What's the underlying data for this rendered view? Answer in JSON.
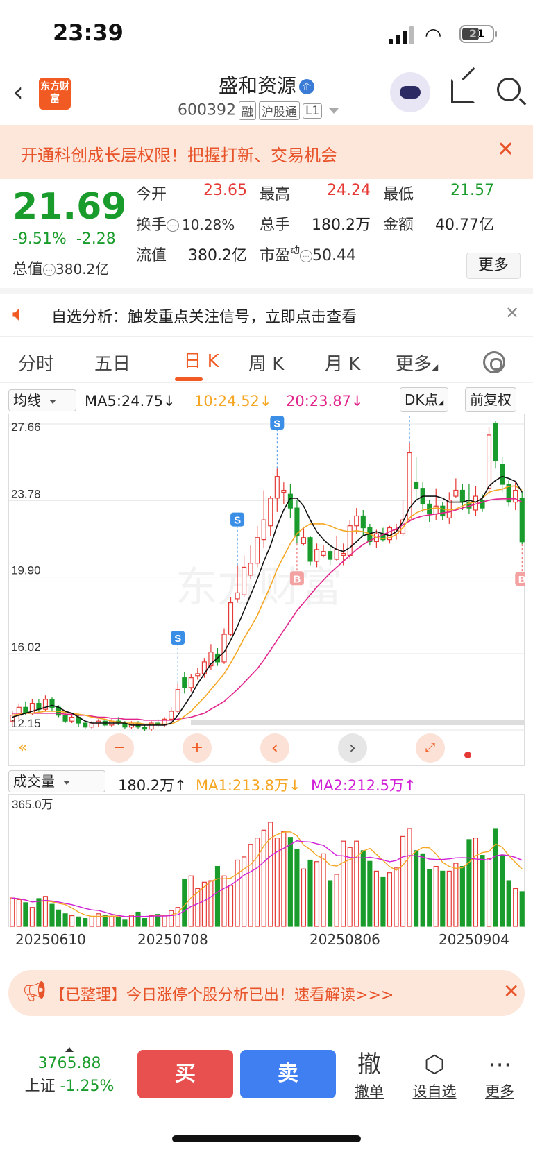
{
  "status": {
    "time": "23:39",
    "battery": "21"
  },
  "header": {
    "back_icon": "chevron-left-icon",
    "logo_text": "东方财富",
    "stock_name": "盛和资源",
    "badge": "企",
    "code": "600392",
    "tags": [
      "融",
      "沪股通",
      "L1"
    ]
  },
  "banner": {
    "text": "开通科创成长层权限！把握打新、交易机会"
  },
  "quote": {
    "price": "21.69",
    "change_pct": "-9.51%",
    "change": "-2.28",
    "open_label": "今开",
    "open": "23.65",
    "high_label": "最高",
    "high": "24.24",
    "low_label": "最低",
    "low": "21.57",
    "turnover_label": "换手",
    "turnover": "10.28%",
    "volume_label": "总手",
    "volume": "180.2万",
    "amount_label": "金额",
    "amount": "40.77亿",
    "mktcap_label": "总值",
    "mktcap": "380.2亿",
    "float_label": "流值",
    "float": "380.2亿",
    "pe_label": "市盈",
    "pe_sup": "动",
    "pe": "50.44",
    "more": "更多"
  },
  "alert": {
    "text": "自选分析：触发重点关注信号，立即点击查看"
  },
  "tabs": {
    "items": [
      "分时",
      "五日",
      "日 K",
      "周 K",
      "月 K",
      "更多"
    ],
    "active": 2
  },
  "ma": {
    "select": "均线",
    "ma5": "MA5:24.75↓",
    "ma10": "10:24.52↓",
    "ma20": "20:23.87↓",
    "dk": "DK点",
    "adj": "前复权",
    "colors": {
      "ma5": "#111111",
      "ma10": "#f5a623",
      "ma20": "#e0248c",
      "up": "#e53935",
      "down": "#1a9c2c"
    }
  },
  "kline": {
    "y_labels": [
      "27.66",
      "23.78",
      "19.90",
      "16.02",
      "12.15"
    ],
    "signals": {
      "sell": "S",
      "buy": "B"
    }
  },
  "volume": {
    "select": "成交量",
    "current": "180.2万↑",
    "ma1": "MA1:213.8万↓",
    "ma2": "MA2:212.5万↑",
    "max_label": "365.0万"
  },
  "dates": [
    "20250610",
    "20250708",
    "20250806",
    "20250904"
  ],
  "promo": {
    "text": "【已整理】今日涨停个股分析已出！速看解读>>>"
  },
  "bottom": {
    "index_value": "3765.88",
    "index_name": "上证",
    "index_change": "-1.25%",
    "buy": "买",
    "sell": "卖",
    "cancel_glyph": "撤",
    "cancel": "撤单",
    "watch": "设自选",
    "more": "更多"
  },
  "chart_data": {
    "type": "candlestick",
    "title": "",
    "y_range": [
      12.15,
      27.66
    ],
    "x_ticks": [
      "20250610",
      "20250708",
      "20250806",
      "20250904"
    ],
    "candles": [
      [
        12.6,
        12.9,
        13.1,
        12.3
      ],
      [
        12.9,
        13.3,
        13.5,
        12.7
      ],
      [
        13.3,
        13.0,
        13.6,
        12.9
      ],
      [
        13.0,
        13.5,
        13.7,
        12.9
      ],
      [
        13.5,
        13.2,
        13.7,
        13.0
      ],
      [
        13.2,
        13.7,
        13.9,
        13.1
      ],
      [
        13.7,
        13.3,
        13.8,
        13.1
      ],
      [
        13.3,
        12.9,
        13.4,
        12.8
      ],
      [
        12.9,
        12.6,
        13.0,
        12.5
      ],
      [
        12.6,
        12.8,
        12.9,
        12.5
      ],
      [
        12.8,
        12.5,
        12.9,
        12.3
      ],
      [
        12.5,
        12.3,
        12.6,
        12.2
      ],
      [
        12.3,
        12.5,
        12.6,
        12.2
      ],
      [
        12.5,
        12.6,
        12.7,
        12.3
      ],
      [
        12.6,
        12.4,
        12.7,
        12.3
      ],
      [
        12.4,
        12.6,
        12.7,
        12.3
      ],
      [
        12.6,
        12.5,
        12.8,
        12.4
      ],
      [
        12.5,
        12.3,
        12.6,
        12.2
      ],
      [
        12.3,
        12.5,
        12.6,
        12.2
      ],
      [
        12.5,
        12.3,
        12.6,
        12.2
      ],
      [
        12.3,
        12.2,
        12.4,
        12.1
      ],
      [
        12.2,
        12.5,
        12.6,
        12.1
      ],
      [
        12.5,
        12.4,
        12.7,
        12.3
      ],
      [
        12.4,
        12.7,
        12.8,
        12.3
      ],
      [
        12.7,
        13.1,
        13.3,
        12.6
      ],
      [
        13.1,
        14.2,
        14.5,
        13.0
      ],
      [
        14.8,
        14.3,
        15.1,
        14.0
      ],
      [
        14.3,
        14.8,
        15.0,
        14.1
      ],
      [
        14.9,
        15.0,
        15.3,
        14.7
      ],
      [
        15.0,
        15.6,
        15.8,
        14.8
      ],
      [
        15.4,
        16.1,
        16.5,
        15.2
      ],
      [
        16.0,
        15.6,
        16.3,
        15.4
      ],
      [
        15.6,
        17.0,
        17.3,
        15.5
      ],
      [
        17.0,
        18.6,
        18.9,
        16.9
      ],
      [
        18.8,
        19.1,
        20.5,
        18.6
      ],
      [
        19.0,
        20.4,
        21.0,
        18.9
      ],
      [
        20.0,
        20.6,
        21.5,
        19.8
      ],
      [
        20.6,
        21.9,
        22.5,
        20.4
      ],
      [
        21.8,
        22.8,
        24.3,
        21.4
      ],
      [
        22.5,
        23.9,
        24.0,
        22.0
      ],
      [
        23.9,
        25.0,
        25.4,
        23.2
      ],
      [
        24.2,
        24.3,
        24.7,
        23.6
      ],
      [
        24.1,
        23.4,
        24.6,
        22.9
      ],
      [
        23.4,
        22.0,
        23.8,
        21.6
      ],
      [
        21.6,
        21.9,
        22.4,
        21.5
      ],
      [
        21.9,
        20.7,
        22.0,
        20.5
      ],
      [
        20.7,
        21.3,
        21.6,
        20.4
      ],
      [
        21.0,
        21.2,
        21.5,
        20.9
      ],
      [
        21.2,
        20.8,
        21.5,
        20.5
      ],
      [
        20.8,
        21.3,
        22.0,
        20.7
      ],
      [
        21.0,
        21.1,
        21.6,
        20.5
      ],
      [
        21.0,
        22.5,
        22.8,
        20.8
      ],
      [
        22.5,
        23.0,
        23.4,
        22.1
      ],
      [
        23.0,
        22.4,
        23.3,
        22.0
      ],
      [
        22.4,
        21.7,
        22.6,
        21.5
      ],
      [
        21.7,
        22.1,
        22.3,
        21.4
      ],
      [
        22.1,
        21.8,
        22.4,
        21.7
      ],
      [
        21.8,
        22.4,
        22.5,
        21.6
      ],
      [
        22.1,
        22.3,
        22.6,
        21.8
      ],
      [
        22.1,
        22.8,
        23.8,
        22.0
      ],
      [
        22.8,
        26.2,
        26.7,
        22.7
      ],
      [
        24.7,
        24.4,
        26.0,
        23.8
      ],
      [
        24.4,
        23.6,
        24.7,
        23.2
      ],
      [
        23.6,
        23.1,
        23.8,
        22.7
      ],
      [
        23.1,
        23.5,
        24.4,
        22.8
      ],
      [
        23.5,
        23.0,
        23.7,
        22.8
      ],
      [
        22.9,
        23.8,
        24.2,
        22.6
      ],
      [
        24.0,
        24.3,
        24.9,
        23.9
      ],
      [
        24.3,
        23.7,
        24.6,
        23.3
      ],
      [
        23.7,
        23.4,
        24.6,
        23.1
      ],
      [
        23.3,
        24.0,
        24.5,
        23.0
      ],
      [
        23.8,
        23.4,
        24.1,
        23.2
      ],
      [
        24.4,
        27.1,
        27.5,
        24.1
      ],
      [
        27.7,
        25.8,
        27.8,
        25.4
      ],
      [
        25.6,
        24.6,
        26.0,
        24.2
      ],
      [
        24.6,
        23.7,
        24.8,
        23.5
      ],
      [
        23.7,
        24.3,
        24.7,
        23.3
      ],
      [
        23.9,
        21.69,
        24.24,
        21.57
      ]
    ],
    "ma5": [
      12.8,
      12.9,
      13.0,
      13.1,
      13.2,
      13.3,
      13.4,
      13.3,
      13.1,
      13.0,
      12.8,
      12.6,
      12.5,
      12.5,
      12.5,
      12.5,
      12.5,
      12.5,
      12.4,
      12.4,
      12.4,
      12.4,
      12.4,
      12.4,
      12.5,
      12.9,
      13.4,
      13.9,
      14.5,
      15.0,
      15.5,
      15.8,
      16.1,
      16.7,
      17.4,
      18.2,
      19.0,
      19.8,
      20.7,
      21.5,
      22.5,
      23.3,
      23.9,
      23.9,
      23.5,
      22.8,
      22.2,
      21.8,
      21.5,
      21.3,
      21.2,
      21.4,
      21.7,
      22.0,
      22.1,
      22.2,
      22.1,
      22.0,
      22.2,
      22.7,
      23.4,
      23.8,
      24.0,
      24.0,
      24.0,
      23.9,
      23.7,
      23.7,
      23.7,
      23.8,
      23.7,
      23.9,
      24.5,
      24.8,
      25.0,
      24.9,
      24.75,
      24.2
    ],
    "ma10": [
      12.9,
      12.95,
      13.0,
      13.0,
      13.05,
      13.1,
      13.1,
      13.1,
      13.05,
      13.0,
      12.95,
      12.9,
      12.8,
      12.75,
      12.7,
      12.6,
      12.55,
      12.5,
      12.5,
      12.5,
      12.45,
      12.45,
      12.45,
      12.45,
      12.45,
      12.6,
      12.85,
      13.1,
      13.45,
      13.8,
      14.2,
      14.6,
      15.0,
      15.55,
      16.15,
      16.8,
      17.35,
      17.95,
      18.7,
      19.45,
      20.3,
      20.95,
      21.6,
      22.1,
      22.4,
      22.6,
      22.6,
      22.6,
      22.5,
      22.35,
      22.25,
      22.2,
      22.25,
      22.2,
      22.1,
      21.9,
      21.85,
      21.9,
      22.05,
      22.4,
      22.9,
      23.15,
      23.3,
      23.35,
      23.4,
      23.35,
      23.3,
      23.35,
      23.5,
      23.65,
      23.7,
      23.9,
      24.2,
      24.3,
      24.35,
      24.5,
      24.52,
      24.3
    ],
    "ma20": [
      13.0,
      13.0,
      13.0,
      13.0,
      13.0,
      13.0,
      13.0,
      13.0,
      12.95,
      12.95,
      12.9,
      12.9,
      12.85,
      12.8,
      12.8,
      12.75,
      12.75,
      12.7,
      12.7,
      12.7,
      12.65,
      12.65,
      12.65,
      12.65,
      12.65,
      12.7,
      12.75,
      12.8,
      12.9,
      13.0,
      13.2,
      13.4,
      13.6,
      13.9,
      14.2,
      14.55,
      14.9,
      15.25,
      15.7,
      16.2,
      16.7,
      17.2,
      17.7,
      18.2,
      18.6,
      19.0,
      19.4,
      19.75,
      20.1,
      20.4,
      20.7,
      21.0,
      21.3,
      21.55,
      21.75,
      21.9,
      22.05,
      22.2,
      22.35,
      22.55,
      22.75,
      22.9,
      23.0,
      23.05,
      23.1,
      23.15,
      23.2,
      23.3,
      23.4,
      23.5,
      23.6,
      23.7,
      23.8,
      23.85,
      23.87,
      23.87,
      23.87,
      23.7
    ],
    "volume_max": 365.0,
    "volume_unit": "万",
    "volume": [
      90,
      85,
      75,
      60,
      88,
      95,
      70,
      52,
      40,
      34,
      30,
      25,
      30,
      40,
      35,
      32,
      28,
      20,
      35,
      45,
      25,
      35,
      38,
      34,
      50,
      60,
      150,
      160,
      120,
      140,
      145,
      190,
      160,
      130,
      210,
      220,
      260,
      280,
      305,
      330,
      280,
      300,
      282,
      245,
      182,
      210,
      205,
      230,
      145,
      165,
      270,
      250,
      270,
      240,
      206,
      175,
      155,
      170,
      185,
      285,
      310,
      240,
      230,
      180,
      190,
      175,
      175,
      200,
      190,
      275,
      280,
      225,
      215,
      310,
      225,
      145,
      120,
      110
    ]
  }
}
